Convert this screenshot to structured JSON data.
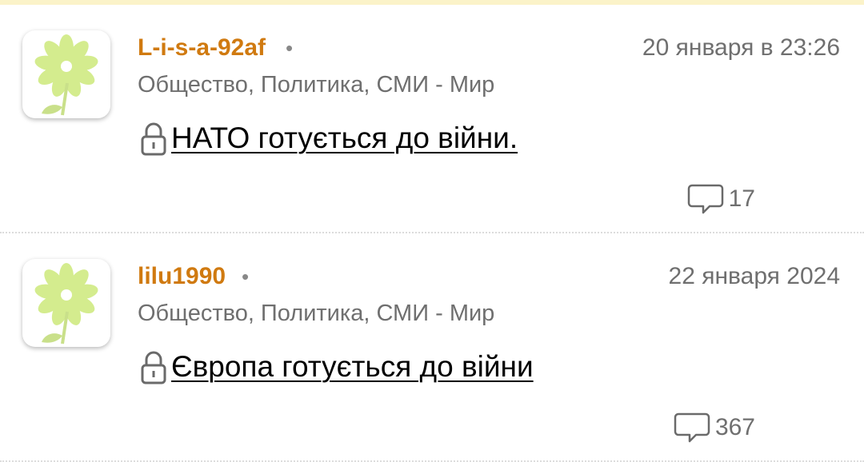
{
  "feed": {
    "posts": [
      {
        "author": "L-i-s-a-92af",
        "separator": "•",
        "date": "20 января в 23:26",
        "category": "Общество, Политика, СМИ - Мир",
        "title": "НАТО готується до війни.",
        "comments": "17",
        "avatar_icon": "flower-icon",
        "lock_icon": "lock-icon",
        "comment_icon": "comment-bubble-icon"
      },
      {
        "author": "lilu1990",
        "separator": "•",
        "date": "22 января 2024",
        "category": "Общество, Политика, СМИ - Мир",
        "title": "Європа готується до війни",
        "comments": "367",
        "avatar_icon": "flower-icon",
        "lock_icon": "lock-icon",
        "comment_icon": "comment-bubble-icon"
      }
    ]
  },
  "colors": {
    "author": "#d07a10",
    "meta_text": "#6f6f6f",
    "title": "#000000",
    "top_strip": "#fbf3c9",
    "flower": "#d4ec8e",
    "stem": "#c9e08a"
  }
}
